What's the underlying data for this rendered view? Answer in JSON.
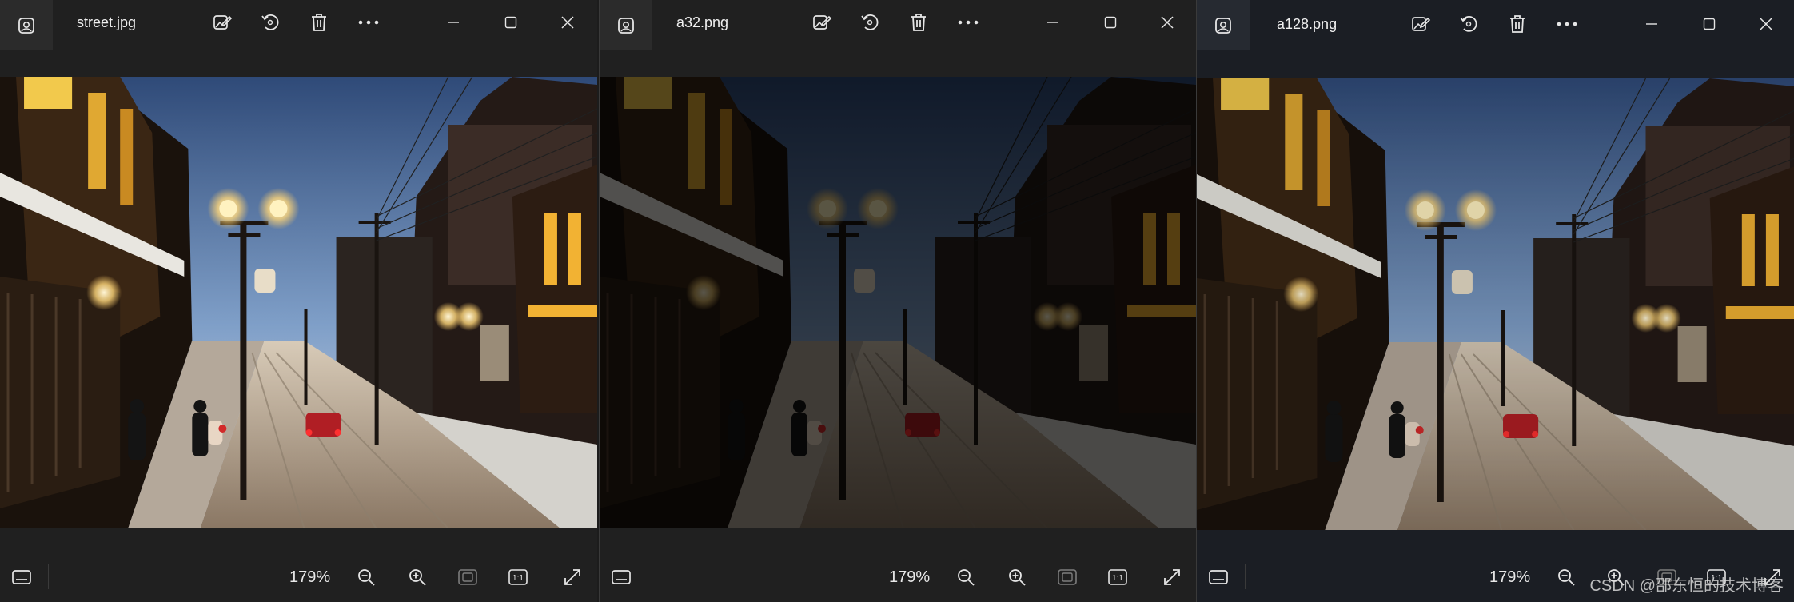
{
  "windows": [
    {
      "title": "street.jpg",
      "zoom": "179%",
      "brightness": 1.0,
      "icons": {
        "app": "photos-app-icon",
        "edit": "edit-image-icon",
        "rotate": "rotate-icon",
        "delete": "delete-icon",
        "more": "more-options-icon",
        "minimize": "minimize-icon",
        "maximize": "maximize-icon",
        "close": "close-icon",
        "filmstrip": "filmstrip-icon",
        "zoom_out": "zoom-out-icon",
        "zoom_in": "zoom-in-icon",
        "fit": "fit-to-window-icon",
        "actual_size": "actual-size-icon",
        "fullscreen": "fullscreen-icon"
      }
    },
    {
      "title": "a32.png",
      "zoom": "179%",
      "brightness": 0.35
    },
    {
      "title": "a128.png",
      "zoom": "179%",
      "brightness": 0.88
    }
  ],
  "actual_size_label": "1:1",
  "watermark": "CSDN @邵东恒的技术博客",
  "colors": {
    "titlebar_bg": "#202020",
    "tint_window_bg": "#1b1e24",
    "icon": "#e6e6e6"
  }
}
